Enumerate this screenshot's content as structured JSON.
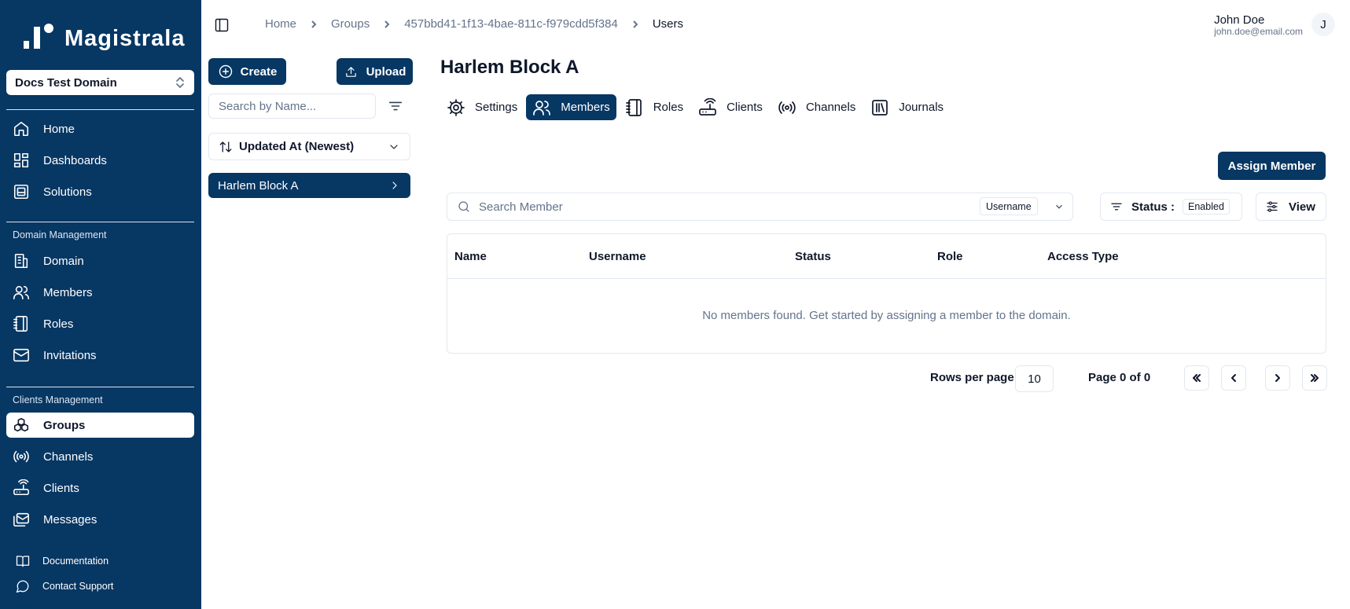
{
  "brand": {
    "name": "Magistrala",
    "primary_color": "#073763"
  },
  "sidebar": {
    "domain_select": {
      "value": "Docs Test Domain",
      "icon": "chevrons-up-down-icon"
    },
    "main_items": [
      {
        "label": "Home",
        "icon": "home-icon"
      },
      {
        "label": "Dashboards",
        "icon": "dashboard-icon"
      },
      {
        "label": "Solutions",
        "icon": "solutions-icon"
      }
    ],
    "domain_management": {
      "heading": "Domain Management",
      "items": [
        {
          "label": "Domain",
          "icon": "building-icon"
        },
        {
          "label": "Members",
          "icon": "users-icon"
        },
        {
          "label": "Roles",
          "icon": "notebook-icon"
        },
        {
          "label": "Invitations",
          "icon": "mail-icon"
        }
      ]
    },
    "clients_management": {
      "heading": "Clients Management",
      "items": [
        {
          "label": "Groups",
          "icon": "boxes-icon",
          "active": true
        },
        {
          "label": "Channels",
          "icon": "radio-icon"
        },
        {
          "label": "Clients",
          "icon": "router-icon"
        },
        {
          "label": "Messages",
          "icon": "mails-icon"
        }
      ]
    },
    "footer": [
      {
        "label": "Documentation",
        "icon": "book-icon"
      },
      {
        "label": "Contact Support",
        "icon": "chat-icon"
      }
    ]
  },
  "header": {
    "breadcrumbs": [
      "Home",
      "Groups",
      "457bbd41-1f13-4bae-811c-f979cdd5f384",
      "Users"
    ],
    "user": {
      "name": "John Doe",
      "email": "john.doe@email.com",
      "avatar_initial": "J"
    }
  },
  "left_panel": {
    "create_label": "Create",
    "upload_label": "Upload",
    "search_placeholder": "Search by Name...",
    "sort_value": "Updated At (Newest)",
    "groups": [
      "Harlem Block A"
    ]
  },
  "main": {
    "title": "Harlem Block A",
    "tabs": [
      {
        "label": "Settings",
        "icon": "gear-icon"
      },
      {
        "label": "Members",
        "icon": "users-icon",
        "active": true
      },
      {
        "label": "Roles",
        "icon": "notebook-icon"
      },
      {
        "label": "Clients",
        "icon": "router-icon"
      },
      {
        "label": "Channels",
        "icon": "radio-icon"
      },
      {
        "label": "Journals",
        "icon": "library-icon"
      }
    ],
    "assign_button": "Assign Member",
    "search_placeholder": "Search Member",
    "search_field": "Username",
    "status_label": "Status :",
    "status_value": "Enabled",
    "view_label": "View",
    "table": {
      "columns": [
        "Name",
        "Username",
        "Status",
        "Role",
        "Access Type"
      ],
      "empty_message": "No members found. Get started by assigning a member to the domain."
    },
    "pagination": {
      "rows_label": "Rows per page",
      "rows_value": "10",
      "page_label": "Page 0 of 0"
    }
  }
}
